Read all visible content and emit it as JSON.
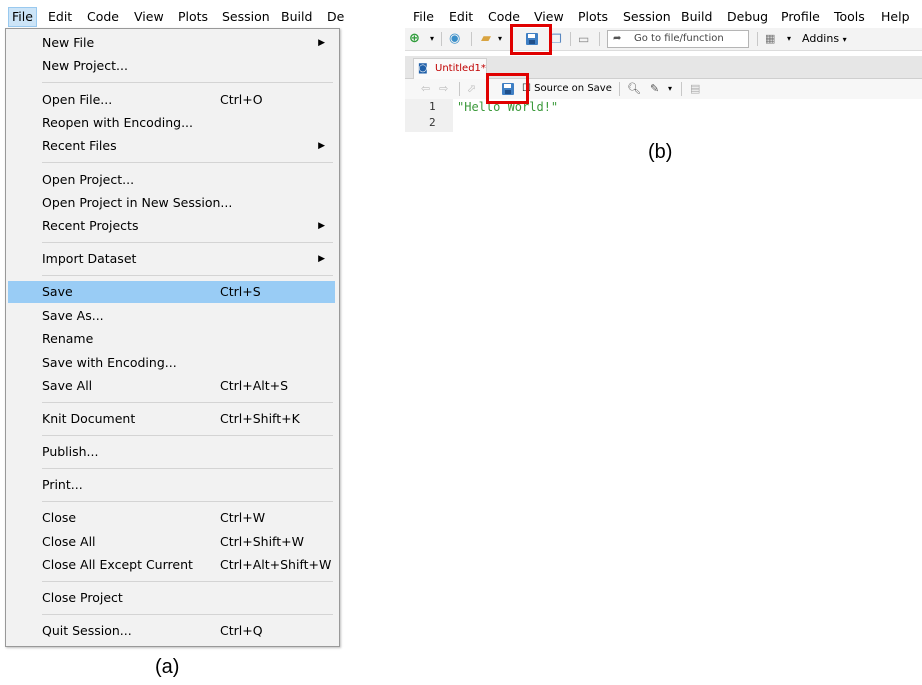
{
  "panel_a": {
    "menubar": [
      "File",
      "Edit",
      "Code",
      "View",
      "Plots",
      "Session",
      "Build",
      "De"
    ],
    "menu_items": [
      {
        "label": "New File",
        "shortcut": "",
        "submenu": true
      },
      {
        "label": "New Project...",
        "shortcut": "",
        "submenu": false
      },
      {
        "label": "Open File...",
        "shortcut": "Ctrl+O",
        "submenu": false
      },
      {
        "label": "Reopen with Encoding...",
        "shortcut": "",
        "submenu": false
      },
      {
        "label": "Recent Files",
        "shortcut": "",
        "submenu": true
      },
      {
        "label": "Open Project...",
        "shortcut": "",
        "submenu": false
      },
      {
        "label": "Open Project in New Session...",
        "shortcut": "",
        "submenu": false
      },
      {
        "label": "Recent Projects",
        "shortcut": "",
        "submenu": true
      },
      {
        "label": "Import Dataset",
        "shortcut": "",
        "submenu": true
      },
      {
        "label": "Save",
        "shortcut": "Ctrl+S",
        "submenu": false,
        "highlighted": true
      },
      {
        "label": "Save As...",
        "shortcut": "",
        "submenu": false
      },
      {
        "label": "Rename",
        "shortcut": "",
        "submenu": false
      },
      {
        "label": "Save with Encoding...",
        "shortcut": "",
        "submenu": false
      },
      {
        "label": "Save All",
        "shortcut": "Ctrl+Alt+S",
        "submenu": false
      },
      {
        "label": "Knit Document",
        "shortcut": "Ctrl+Shift+K",
        "submenu": false
      },
      {
        "label": "Publish...",
        "shortcut": "",
        "submenu": false
      },
      {
        "label": "Print...",
        "shortcut": "",
        "submenu": false
      },
      {
        "label": "Close",
        "shortcut": "Ctrl+W",
        "submenu": false
      },
      {
        "label": "Close All",
        "shortcut": "Ctrl+Shift+W",
        "submenu": false
      },
      {
        "label": "Close All Except Current",
        "shortcut": "Ctrl+Alt+Shift+W",
        "submenu": false
      },
      {
        "label": "Close Project",
        "shortcut": "",
        "submenu": false
      },
      {
        "label": "Quit Session...",
        "shortcut": "Ctrl+Q",
        "submenu": false
      }
    ],
    "caption": "(a)"
  },
  "panel_b": {
    "menubar": [
      "File",
      "Edit",
      "Code",
      "View",
      "Plots",
      "Session",
      "Build",
      "Debug",
      "Profile",
      "Tools",
      "Help"
    ],
    "toolbar": {
      "goto_placeholder": "Go to file/function",
      "addins_label": "Addins"
    },
    "tab_label": "Untitled1*",
    "source_on_save_label": "Source on Save",
    "code_lines": [
      {
        "number": "1",
        "text": "\"Hello World!\""
      },
      {
        "number": "2",
        "text": ""
      }
    ],
    "caption": "(b)"
  },
  "colors": {
    "highlight": "#99ccf5",
    "annotation": "#e00000",
    "string": "#3c9a3c"
  }
}
